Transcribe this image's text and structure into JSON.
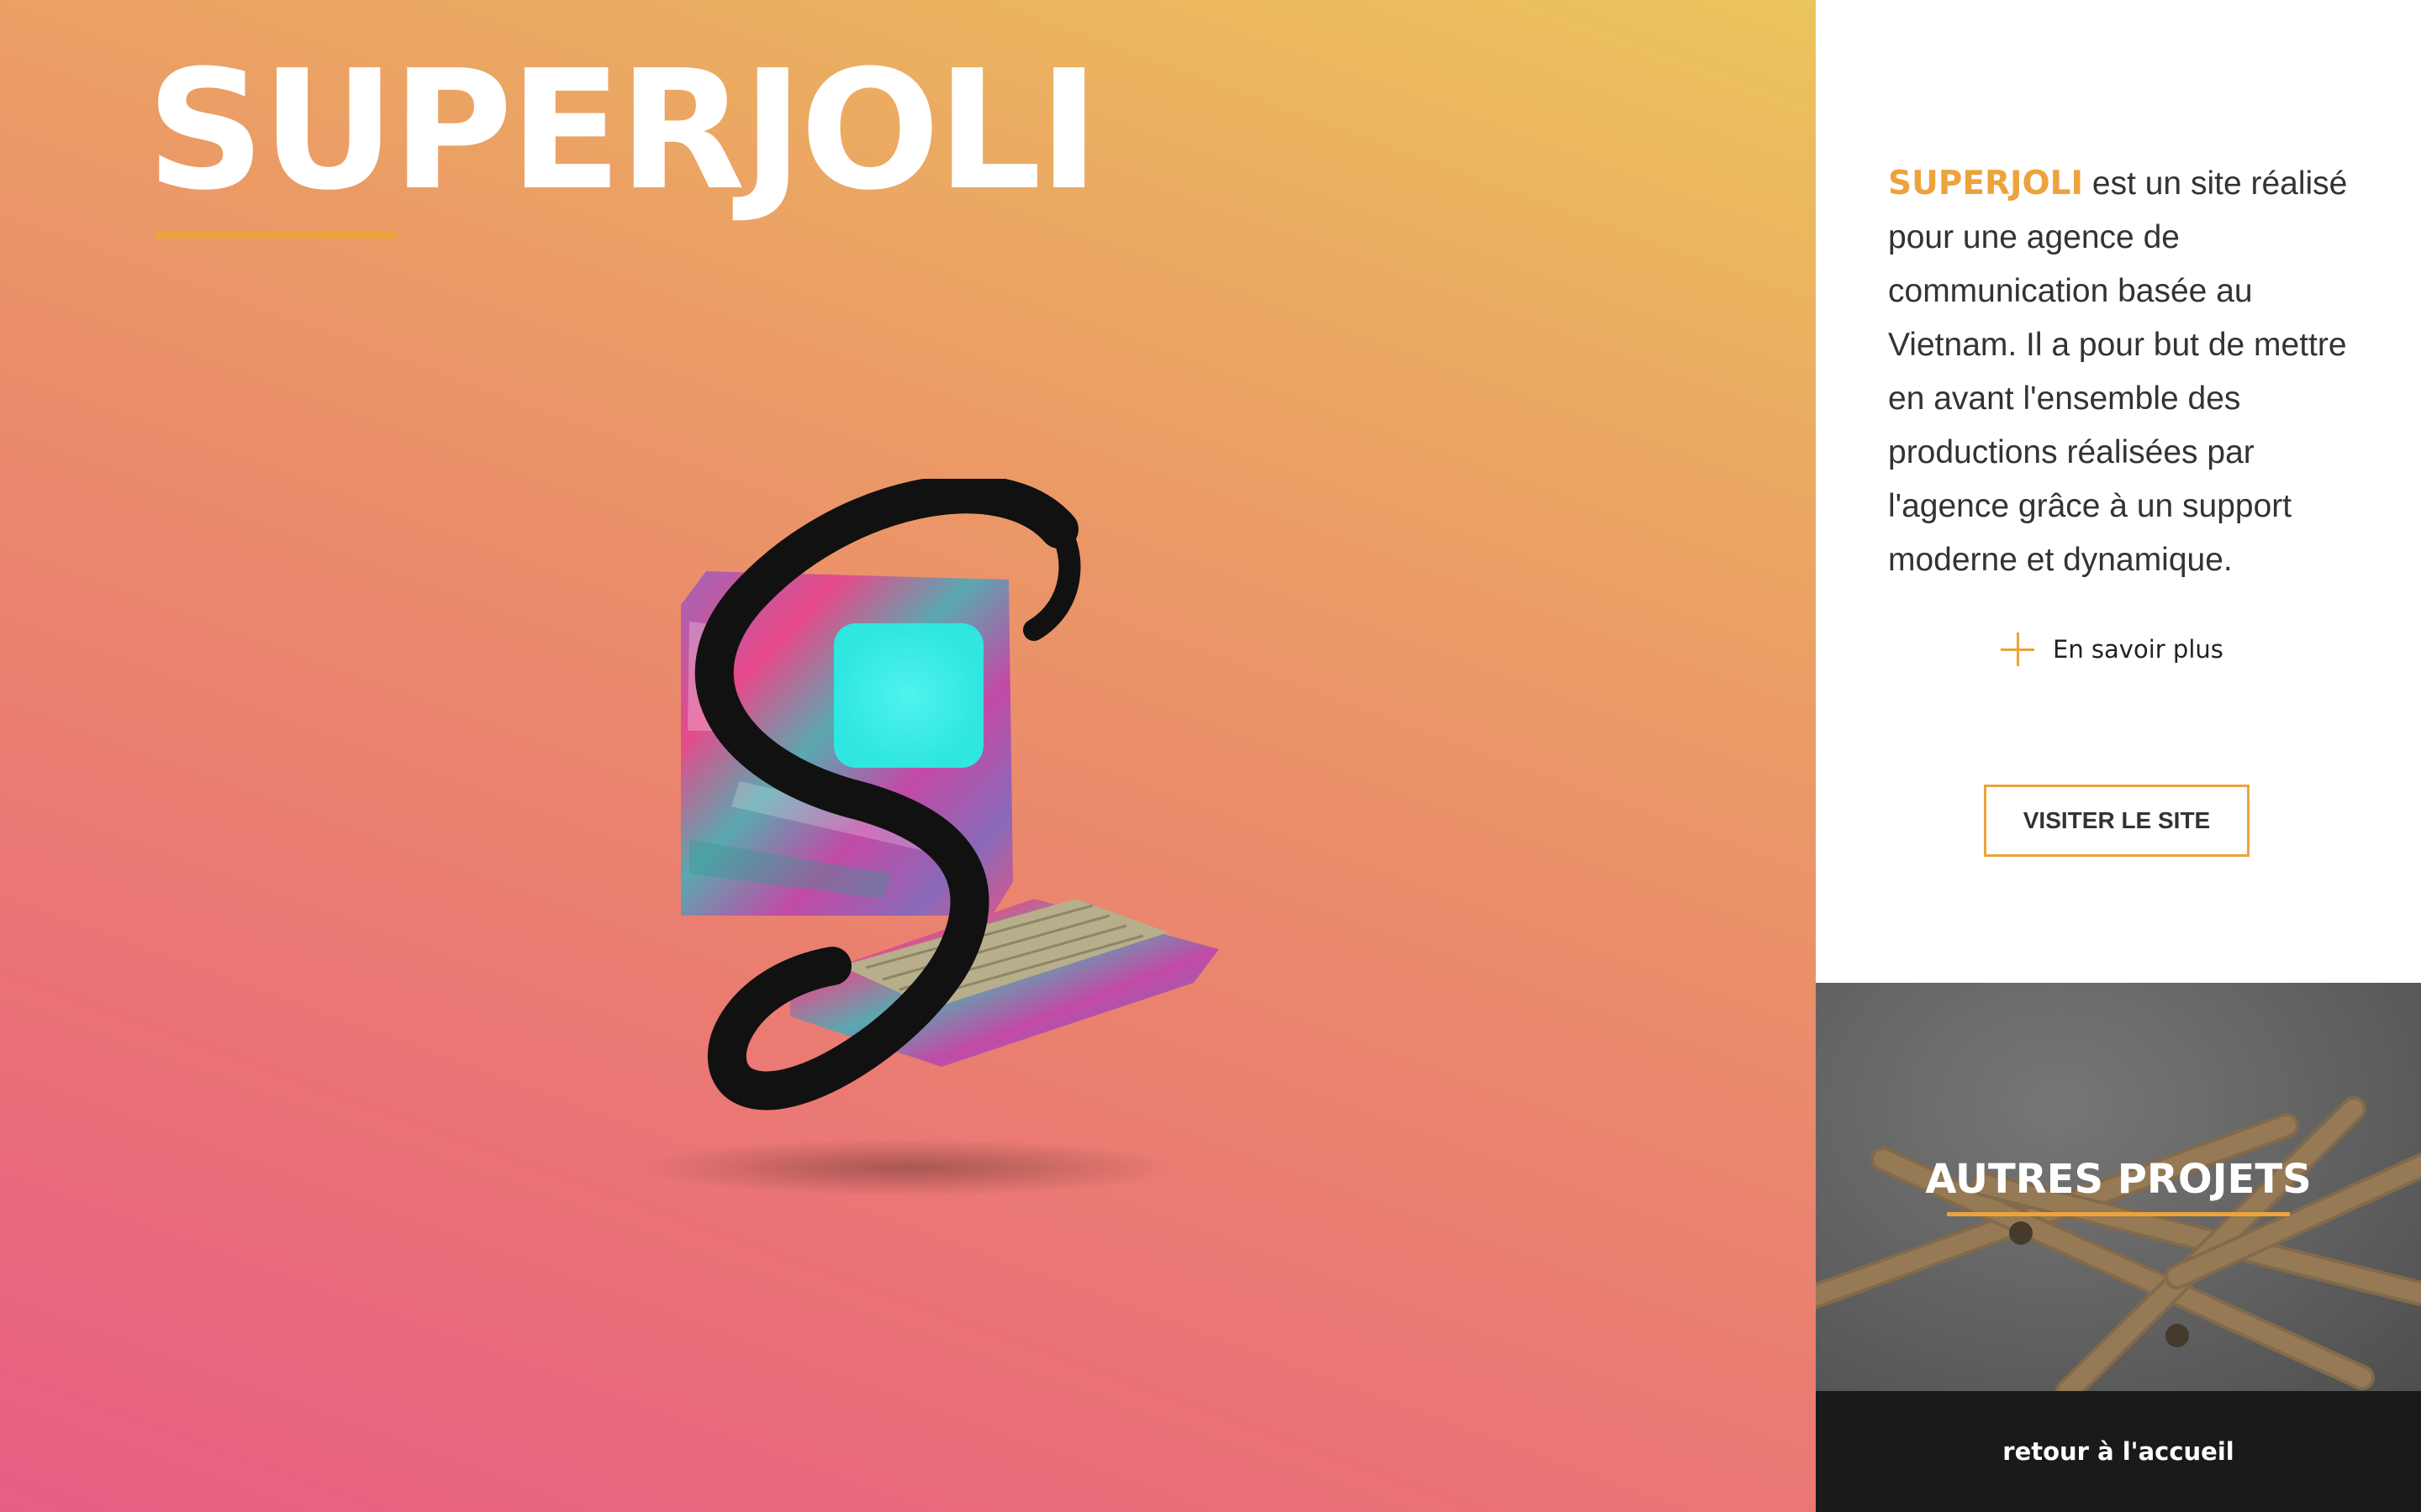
{
  "hero": {
    "title": "SUPERJOLI"
  },
  "panel": {
    "brand_word": "SUPERJOLI",
    "description": " est un site réalisé pour une agence de communication basée au Vietnam. Il a pour but de mettre en avant l'ensemble des productions réalisées par l'agence grâce à un support moderne et dynamique.",
    "more_icon": "plus-icon",
    "more_label": "En savoir plus",
    "visit_button": "VISITER LE SITE"
  },
  "projects": {
    "title": "AUTRES PROJETS"
  },
  "footer": {
    "back_home": "retour à l'accueil"
  },
  "colors": {
    "accent": "#eda33b",
    "footer_bg": "#1a1a1a",
    "text_dark": "#333333"
  }
}
